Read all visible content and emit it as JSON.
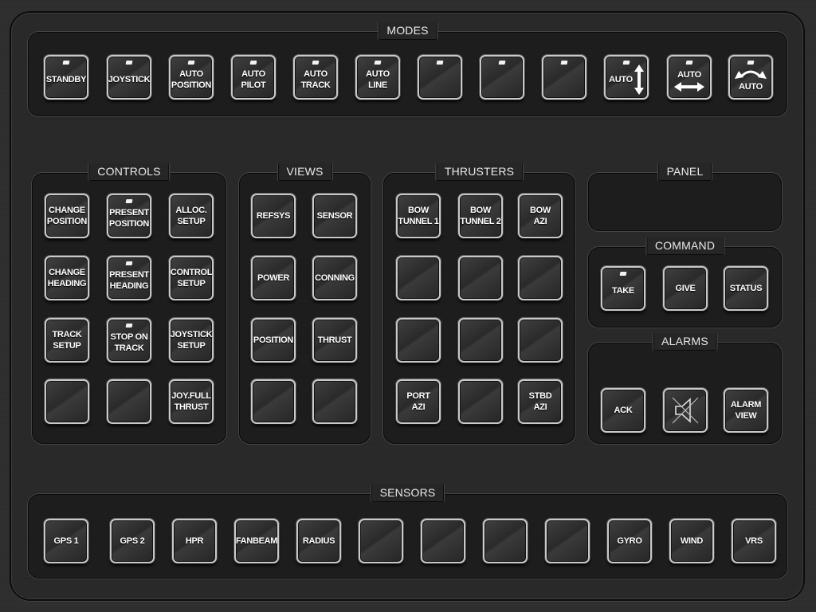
{
  "groups": {
    "modes": {
      "title": "MODES",
      "buttons": [
        {
          "label": "STANDBY",
          "led": true
        },
        {
          "label": "JOYSTICK",
          "led": true
        },
        {
          "label": "AUTO\nPOSITION",
          "led": true
        },
        {
          "label": "AUTO\nPILOT",
          "led": true
        },
        {
          "label": "AUTO\nTRACK",
          "led": true
        },
        {
          "label": "AUTO\nLINE",
          "led": true
        },
        {
          "label": "",
          "led": true
        },
        {
          "label": "",
          "led": true
        },
        {
          "label": "",
          "led": true
        },
        {
          "label": "AUTO",
          "led": true,
          "icon": "vertical-arrow-icon"
        },
        {
          "label": "AUTO",
          "led": true,
          "icon": "horizontal-arrow-icon"
        },
        {
          "label": "AUTO",
          "led": true,
          "icon": "rotate-arrow-icon"
        }
      ]
    },
    "controls": {
      "title": "CONTROLS",
      "buttons": [
        {
          "label": "CHANGE\nPOSITION",
          "led": false
        },
        {
          "label": "PRESENT\nPOSITION",
          "led": true
        },
        {
          "label": "ALLOC.\nSETUP",
          "led": false
        },
        {
          "label": "CHANGE\nHEADING",
          "led": false
        },
        {
          "label": "PRESENT\nHEADING",
          "led": true
        },
        {
          "label": "CONTROL\nSETUP",
          "led": false
        },
        {
          "label": "TRACK\nSETUP",
          "led": false
        },
        {
          "label": "STOP ON\nTRACK",
          "led": true
        },
        {
          "label": "JOYSTICK\nSETUP",
          "led": false
        },
        {
          "label": "",
          "led": false
        },
        {
          "label": "",
          "led": false
        },
        {
          "label": "JOY.FULL\nTHRUST",
          "led": false
        }
      ]
    },
    "views": {
      "title": "VIEWS",
      "buttons": [
        {
          "label": "REFSYS"
        },
        {
          "label": "SENSOR"
        },
        {
          "label": "POWER"
        },
        {
          "label": "CONNING"
        },
        {
          "label": "POSITION"
        },
        {
          "label": "THRUST"
        },
        {
          "label": ""
        },
        {
          "label": ""
        }
      ]
    },
    "thrusters": {
      "title": "THRUSTERS",
      "buttons": [
        {
          "label": "BOW\nTUNNEL 1"
        },
        {
          "label": "BOW\nTUNNEL 2"
        },
        {
          "label": "BOW\nAZI"
        },
        {
          "label": ""
        },
        {
          "label": ""
        },
        {
          "label": ""
        },
        {
          "label": ""
        },
        {
          "label": ""
        },
        {
          "label": ""
        },
        {
          "label": "PORT\nAZI"
        },
        {
          "label": ""
        },
        {
          "label": "STBD\nAZI"
        }
      ]
    },
    "panel": {
      "title": "PANEL"
    },
    "command": {
      "title": "COMMAND",
      "buttons": [
        {
          "label": "TAKE",
          "led": true
        },
        {
          "label": "GIVE",
          "led": false
        },
        {
          "label": "STATUS",
          "led": false
        }
      ]
    },
    "alarms": {
      "title": "ALARMS",
      "buttons": [
        {
          "label": "ACK"
        },
        {
          "label": "",
          "icon": "speaker-muted-icon"
        },
        {
          "label": "ALARM\nVIEW"
        }
      ]
    },
    "sensors": {
      "title": "SENSORS",
      "buttons": [
        {
          "label": "GPS 1"
        },
        {
          "label": "GPS 2"
        },
        {
          "label": "HPR"
        },
        {
          "label": "FANBEAM"
        },
        {
          "label": "RADIUS"
        },
        {
          "label": ""
        },
        {
          "label": ""
        },
        {
          "label": ""
        },
        {
          "label": ""
        },
        {
          "label": "GYRO"
        },
        {
          "label": "WIND"
        },
        {
          "label": "VRS"
        }
      ]
    }
  }
}
